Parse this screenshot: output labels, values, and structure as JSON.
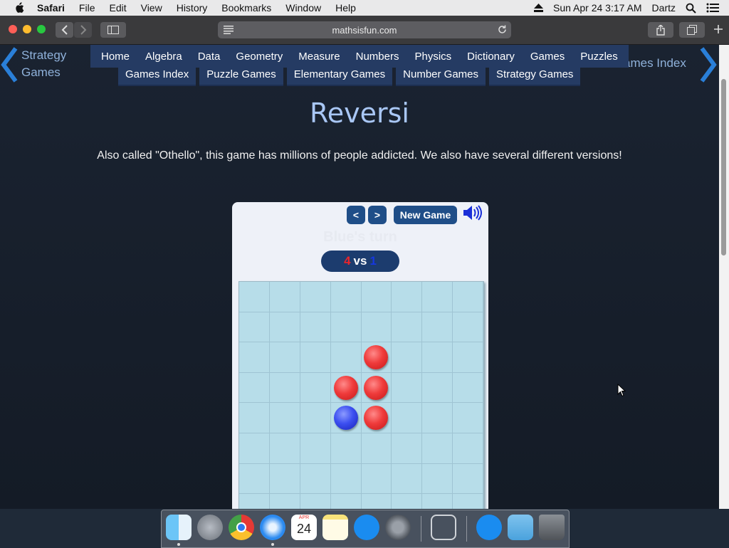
{
  "menubar": {
    "app_name": "Safari",
    "menus": [
      "File",
      "Edit",
      "View",
      "History",
      "Bookmarks",
      "Window",
      "Help"
    ],
    "datetime": "Sun Apr 24  3:17 AM",
    "user": "Dartz"
  },
  "browser": {
    "url": "mathsisfun.com"
  },
  "page": {
    "prev_link": [
      "Strategy",
      "Games"
    ],
    "next_link": "ames Index",
    "nav": [
      "Home",
      "Algebra",
      "Data",
      "Geometry",
      "Measure",
      "Numbers",
      "Physics",
      "Dictionary",
      "Games",
      "Puzzles"
    ],
    "subnav": [
      "Games Index",
      "Puzzle Games",
      "Elementary Games",
      "Number Games",
      "Strategy Games"
    ],
    "title": "Reversi",
    "description": "Also called \"Othello\", this game has millions of people addicted. We also have several different versions!"
  },
  "game": {
    "undo_label": "<",
    "redo_label": ">",
    "new_game_label": "New Game",
    "turn_text": "Blue's turn",
    "score": {
      "red": "4",
      "vs": "vs",
      "blue": "1"
    },
    "board": [
      [
        null,
        null,
        null,
        null,
        null,
        null,
        null,
        null
      ],
      [
        null,
        null,
        null,
        null,
        null,
        null,
        null,
        null
      ],
      [
        null,
        null,
        null,
        null,
        "red",
        null,
        null,
        null
      ],
      [
        null,
        null,
        null,
        "red",
        "red",
        null,
        null,
        null
      ],
      [
        null,
        null,
        null,
        "blue",
        "red",
        null,
        null,
        null
      ],
      [
        null,
        null,
        null,
        null,
        null,
        null,
        null,
        null
      ],
      [
        null,
        null,
        null,
        null,
        null,
        null,
        null,
        null
      ],
      [
        null,
        null,
        null,
        null,
        null,
        null,
        null,
        null
      ]
    ],
    "colors": {
      "red": "#e8242b",
      "blue": "#1638e0",
      "board": "#b7dde9"
    }
  },
  "dock": {
    "apps": [
      "finder-icon",
      "launchpad-icon",
      "chrome-icon",
      "safari-icon",
      "calendar-icon",
      "notes-icon",
      "app-store-icon",
      "system-preferences-icon",
      "screenshot-icon",
      "app-store-icon",
      "downloads-folder-icon",
      "trash-icon"
    ],
    "calendar_month": "APR",
    "calendar_day": "24"
  }
}
